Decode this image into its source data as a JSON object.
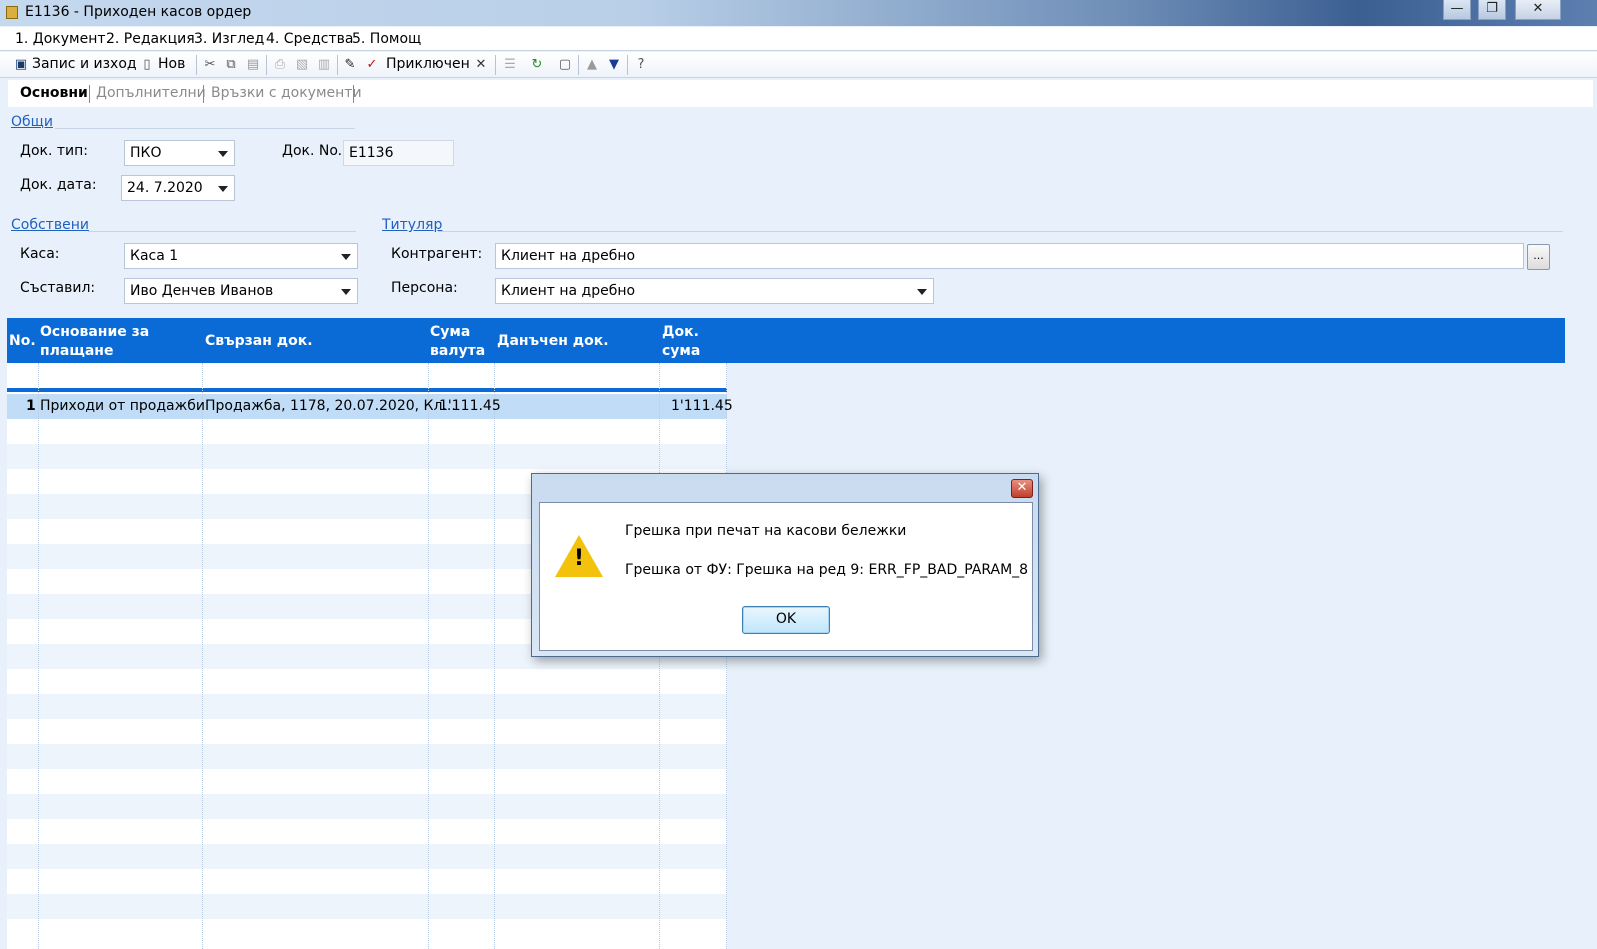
{
  "window": {
    "title": "E1136 - Приходен касов ордер",
    "minimize": "—",
    "restore": "❐",
    "close": "✕"
  },
  "menu": {
    "items": [
      "1. Документ",
      "2. Редакция",
      "3. Изглед",
      "4. Средства",
      "5. Помощ"
    ]
  },
  "toolbar": {
    "save_exit": "Запис и изход",
    "new": "Нов",
    "finished": "Приключен"
  },
  "tabs": [
    "Основни",
    "Допълнителни",
    "Връзки с документи"
  ],
  "general": {
    "section": "Общи",
    "doc_type_label": "Док. тип:",
    "doc_type_value": "ПКО",
    "doc_no_label": "Док. No.",
    "doc_no_value": "E1136",
    "doc_date_label": "Док. дата:",
    "doc_date_value": "24.  7.2020"
  },
  "own": {
    "section": "Собствени",
    "cash_label": "Каса:",
    "cash_value": "Каса 1",
    "author_label": "Съставил:",
    "author_value": "Иво Денчев Иванов"
  },
  "holder": {
    "section": "Титуляр",
    "contragent_label": "Контрагент:",
    "contragent_value": "Клиент на дребно",
    "browse": "...",
    "person_label": "Персона:",
    "person_value": "Клиент на дребно"
  },
  "grid": {
    "headers": {
      "no": "No.",
      "basis_1": "Основание за",
      "basis_2": "плащане",
      "linked": "Свързан док.",
      "amount_1": "Сума",
      "amount_2": "валута",
      "tax": "Данъчен док.",
      "docsum_1": "Док.",
      "docsum_2": "сума"
    },
    "rows": [
      {
        "no": "1",
        "basis": "Приходи от продажби",
        "linked": "Продажба, 1178, 20.07.2020, Кл...",
        "amount": "1'111.45",
        "tax": "",
        "docsum": "1'111.45"
      }
    ]
  },
  "dialog": {
    "message": "Грешка при печат на касови бележки",
    "detail": "Грешка от ФУ: Грешка на ред 9: ERR_FP_BAD_PARAM_8",
    "ok": "OK",
    "close": "✕"
  }
}
